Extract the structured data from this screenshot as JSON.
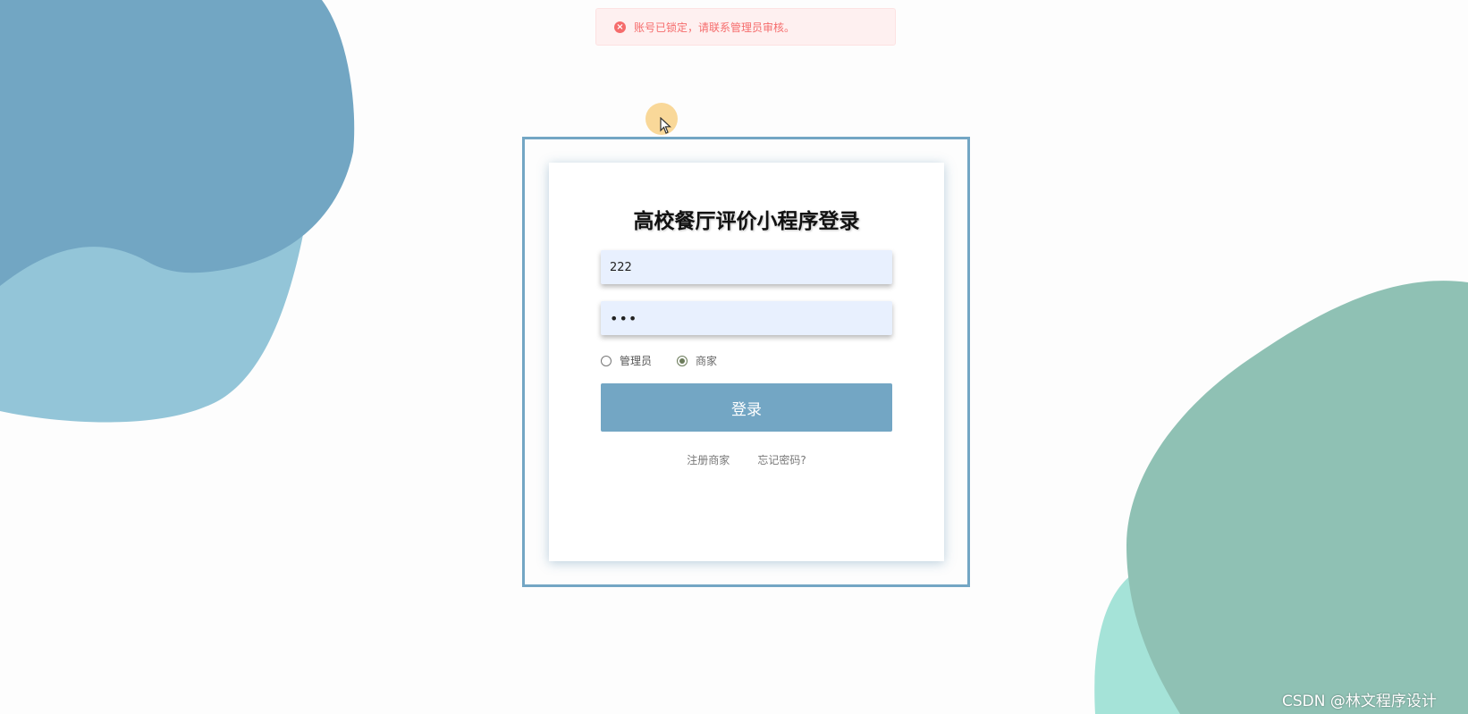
{
  "alert": {
    "icon": "error-circle-icon",
    "message": "账号已锁定，请联系管理员审核。",
    "color": "#f56c6c"
  },
  "login": {
    "title": "高校餐厅评价小程序登录",
    "username_value": "222",
    "password_value": "•••",
    "roles": [
      {
        "label": "管理员",
        "selected": false
      },
      {
        "label": "商家",
        "selected": true
      }
    ],
    "submit_label": "登录",
    "links": {
      "register": "注册商家",
      "forgot": "忘记密码?"
    }
  },
  "theme": {
    "primary": "#73a6c4",
    "blob_blue_dark": "#72a6c3",
    "blob_blue_light": "#93c5d8",
    "blob_green_dark": "#8fc1b4",
    "blob_green_light": "#a5e3d8"
  },
  "watermark": "CSDN @林文程序设计"
}
